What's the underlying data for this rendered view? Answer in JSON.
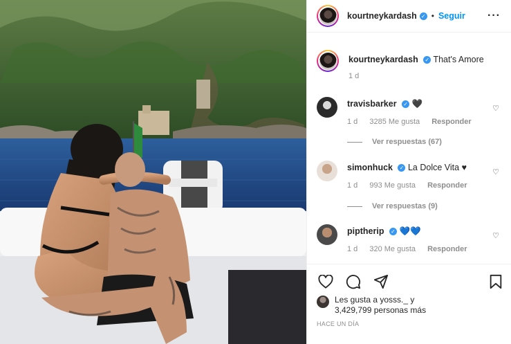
{
  "post": {
    "username": "kourtneykardash",
    "follow_label": "Seguir",
    "separator": "•",
    "more_label": "···"
  },
  "caption": {
    "username": "kourtneykardash",
    "text": "That's Amore",
    "time": "1 d"
  },
  "comments": [
    {
      "username": "travisbarker",
      "text": "🖤",
      "time": "1 d",
      "likes": "3285 Me gusta",
      "reply_label": "Responder",
      "view_replies": "Ver respuestas (67)",
      "verified": true
    },
    {
      "username": "simonhuck",
      "text": "La Dolce Vita ♥",
      "time": "1 d",
      "likes": "993 Me gusta",
      "reply_label": "Responder",
      "view_replies": "Ver respuestas (9)",
      "verified": true
    },
    {
      "username": "piptherip",
      "text": "💙💙",
      "time": "1 d",
      "likes": "320 Me gusta",
      "reply_label": "Responder",
      "verified": true
    }
  ],
  "likes_summary": {
    "line1": "Les gusta a yosss._ y",
    "line2": "3,429,799 personas más"
  },
  "timestamp": "HACE UN DÍA",
  "icons": {
    "heart": "heart-icon",
    "comment": "comment-icon",
    "share": "share-icon",
    "bookmark": "bookmark-icon",
    "verified": "verified-badge-icon"
  },
  "colors": {
    "link_blue": "#0095f6",
    "verified_blue": "#3897f0",
    "muted_text": "#8e8e8e",
    "border": "#efefef"
  }
}
